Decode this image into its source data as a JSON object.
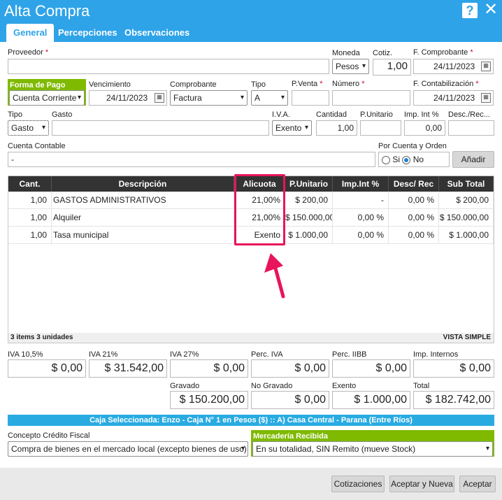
{
  "window": {
    "title": "Alta Compra"
  },
  "tabs": [
    "General",
    "Percepciones",
    "Observaciones"
  ],
  "form": {
    "proveedor_label": "Proveedor",
    "proveedor_value": "",
    "moneda_label": "Moneda",
    "moneda_value": "Pesos",
    "cotiz_label": "Cotiz.",
    "cotiz_value": "1,00",
    "f_comprobante_label": "F. Comprobante",
    "f_comprobante_value": "24/11/2023",
    "forma_pago_label": "Forma de Pago",
    "forma_pago_value": "Cuenta Corriente",
    "vencimiento_label": "Vencimiento",
    "vencimiento_value": "24/11/2023",
    "comprobante_label": "Comprobante",
    "comprobante_value": "Factura",
    "tipo_label": "Tipo",
    "tipo_value": "A",
    "pventa_label": "P.Venta",
    "pventa_value": "",
    "numero_label": "Número",
    "numero_value": "",
    "f_contab_label": "F. Contabilización",
    "f_contab_value": "24/11/2023",
    "tipo2_label": "Tipo",
    "tipo2_value": "Gasto",
    "gasto_label": "Gasto",
    "gasto_value": "",
    "iva_label": "I.V.A.",
    "iva_value": "Exento",
    "cantidad_label": "Cantidad",
    "cantidad_value": "1,00",
    "punitario_label": "P.Unitario",
    "punitario_value": "",
    "impint_label": "Imp. Int %",
    "impint_value": "0,00",
    "desc_label": "Desc./Rec...",
    "desc_value": "",
    "cuenta_label": "Cuenta Contable",
    "cuenta_value": "-",
    "porcuenta_label": "Por Cuenta y Orden",
    "si_label": "Si",
    "no_label": "No",
    "anadir_label": "Añadir"
  },
  "grid": {
    "headers": [
      "Cant.",
      "Descripción",
      "Alicuota",
      "P.Unitario",
      "Imp.Int %",
      "Desc/ Rec",
      "Sub Total"
    ],
    "rows": [
      [
        "1,00",
        "GASTOS ADMINISTRATIVOS",
        "21,00%",
        "$ 200,00",
        "-",
        "0,00 %",
        "$ 200,00"
      ],
      [
        "1,00",
        "Alquiler",
        "21,00%",
        "$ 150.000,00",
        "0,00 %",
        "0,00 %",
        "$ 150.000,00"
      ],
      [
        "1,00",
        "Tasa municipal",
        "Exento",
        "$ 1.000,00",
        "0,00 %",
        "0,00 %",
        "$ 1.000,00"
      ]
    ],
    "footer_left": "3 items  3 unidades",
    "footer_right": "VISTA SIMPLE"
  },
  "totals": {
    "iva105_label": "IVA 10,5%",
    "iva105": "$ 0,00",
    "iva21_label": "IVA 21%",
    "iva21": "$ 31.542,00",
    "iva27_label": "IVA 27%",
    "iva27": "$ 0,00",
    "perciva_label": "Perc. IVA",
    "perciva": "$ 0,00",
    "perciibb_label": "Perc. IIBB",
    "perciibb": "$ 0,00",
    "impint_label": "Imp. Internos",
    "impint": "$ 0,00",
    "gravado_label": "Gravado",
    "gravado": "$ 150.200,00",
    "nogravado_label": "No Gravado",
    "nogravado": "$ 0,00",
    "exento_label": "Exento",
    "exento": "$ 1.000,00",
    "total_label": "Total",
    "total": "$ 182.742,00"
  },
  "caja": "Caja Seleccionada: Enzo - Caja N° 1 en Pesos ($) :: A) Casa Central - Parana (Entre Ríos)",
  "credito": {
    "label": "Concepto Crédito Fiscal",
    "value": "Compra de bienes en el mercado local (excepto bienes de uso)"
  },
  "mercaderia": {
    "label": "Mercadería Recibida",
    "value": "En su totalidad, SIN Remito (mueve Stock)"
  },
  "buttons": {
    "cotizaciones": "Cotizaciones",
    "aceptar_nueva": "Aceptar y Nueva",
    "aceptar": "Aceptar"
  },
  "colors": {
    "header": "#2ea3e8",
    "accent_green": "#7fba00",
    "highlight": "#e8155a"
  }
}
